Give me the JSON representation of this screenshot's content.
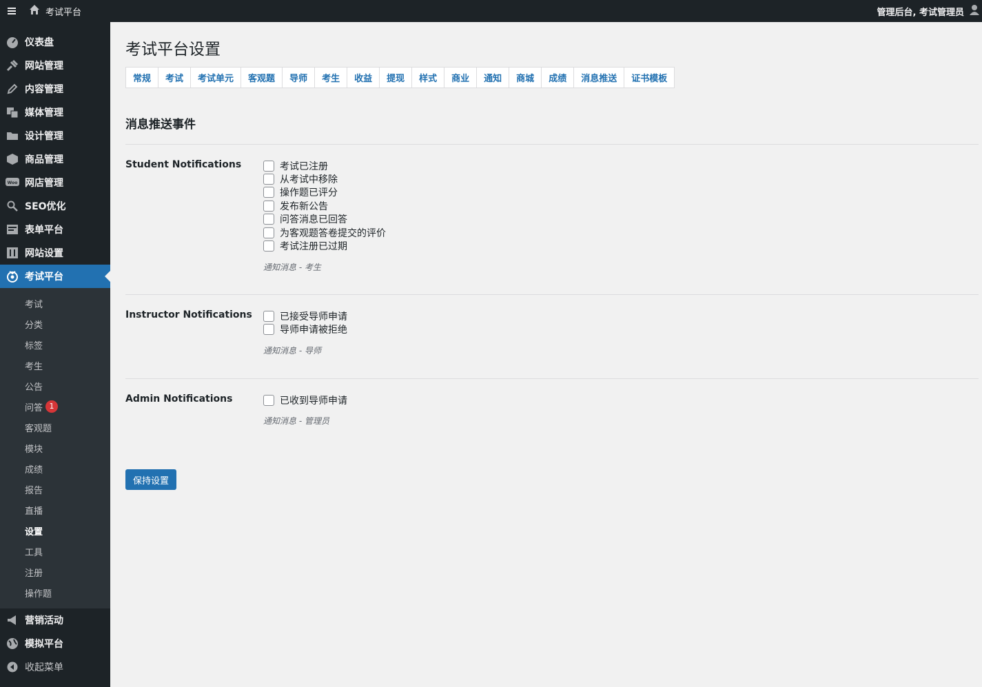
{
  "adminbar": {
    "site_name": "考试平台",
    "account_label": "管理后台, 考试管理员"
  },
  "sidebar": {
    "items": [
      {
        "label": "仪表盘",
        "icon": "dashboard-icon"
      },
      {
        "label": "网站管理",
        "icon": "pin-icon"
      },
      {
        "label": "内容管理",
        "icon": "pencil-icon"
      },
      {
        "label": "媒体管理",
        "icon": "media-icon"
      },
      {
        "label": "设计管理",
        "icon": "folder-icon"
      },
      {
        "label": "商品管理",
        "icon": "box-icon"
      },
      {
        "label": "网店管理",
        "icon": "woo-icon"
      },
      {
        "label": "SEO优化",
        "icon": "search-icon"
      },
      {
        "label": "表单平台",
        "icon": "form-icon"
      },
      {
        "label": "网站设置",
        "icon": "settings-icon"
      },
      {
        "label": "考试平台",
        "icon": "exam-icon"
      }
    ],
    "submenu": [
      "考试",
      "分类",
      "标签",
      "考生",
      "公告",
      "问答",
      "客观题",
      "模块",
      "成绩",
      "报告",
      "直播",
      "设置",
      "工具",
      "注册",
      "操作题"
    ],
    "qa_badge": "1",
    "bottom_items": [
      {
        "label": "营销活动",
        "icon": "megaphone-icon"
      },
      {
        "label": "模拟平台",
        "icon": "globe-icon"
      }
    ],
    "collapse_label": "收起菜单"
  },
  "page": {
    "title": "考试平台设置",
    "tabs": [
      "常规",
      "考试",
      "考试单元",
      "客观题",
      "导师",
      "考生",
      "收益",
      "提现",
      "样式",
      "商业",
      "通知",
      "商城",
      "成绩",
      "消息推送",
      "证书模板"
    ],
    "section_heading": "消息推送事件",
    "groups": {
      "student": {
        "label": "Student Notifications",
        "options": [
          "考试已注册",
          "从考试中移除",
          "操作题已评分",
          "发布新公告",
          "问答消息已回答",
          "为客观题答卷提交的评价",
          "考试注册已过期"
        ],
        "description": "通知消息 - 考生"
      },
      "instructor": {
        "label": "Instructor Notifications",
        "options": [
          "已接受导师申请",
          "导师申请被拒绝"
        ],
        "description": "通知消息 - 导师"
      },
      "admin": {
        "label": "Admin Notifications",
        "options": [
          "已收到导师申请"
        ],
        "description": "通知消息 - 管理员"
      }
    },
    "save_label": "保持设置"
  },
  "colors": {
    "accent": "#2271b1",
    "sidebar_bg": "#1d2327",
    "submenu_bg": "#2c3338",
    "badge": "#d63638"
  }
}
